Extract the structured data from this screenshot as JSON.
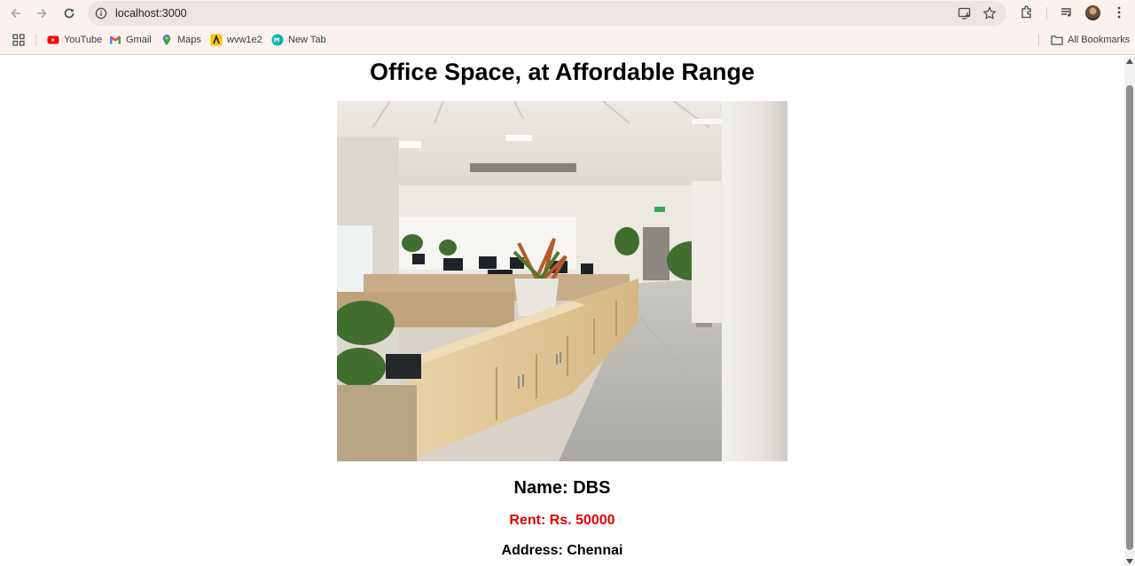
{
  "browser": {
    "url": "localhost:3000",
    "bookmarks": [
      {
        "label": "YouTube",
        "icon": "youtube-icon"
      },
      {
        "label": "Gmail",
        "icon": "gmail-icon"
      },
      {
        "label": "Maps",
        "icon": "maps-icon"
      },
      {
        "label": "wvw1e2",
        "icon": "wvw-icon"
      },
      {
        "label": "New Tab",
        "icon": "newtab-icon"
      }
    ],
    "all_bookmarks_label": "All Bookmarks"
  },
  "page": {
    "title": "Office Space, at Affordable Range",
    "name": "Name: DBS",
    "rent": "Rent: Rs. 50000",
    "address": "Address: Chennai"
  },
  "colors": {
    "rent_text": "#e00000",
    "chrome_bg": "#fbf1ef",
    "omnibox_bg": "#f0e4e2"
  }
}
